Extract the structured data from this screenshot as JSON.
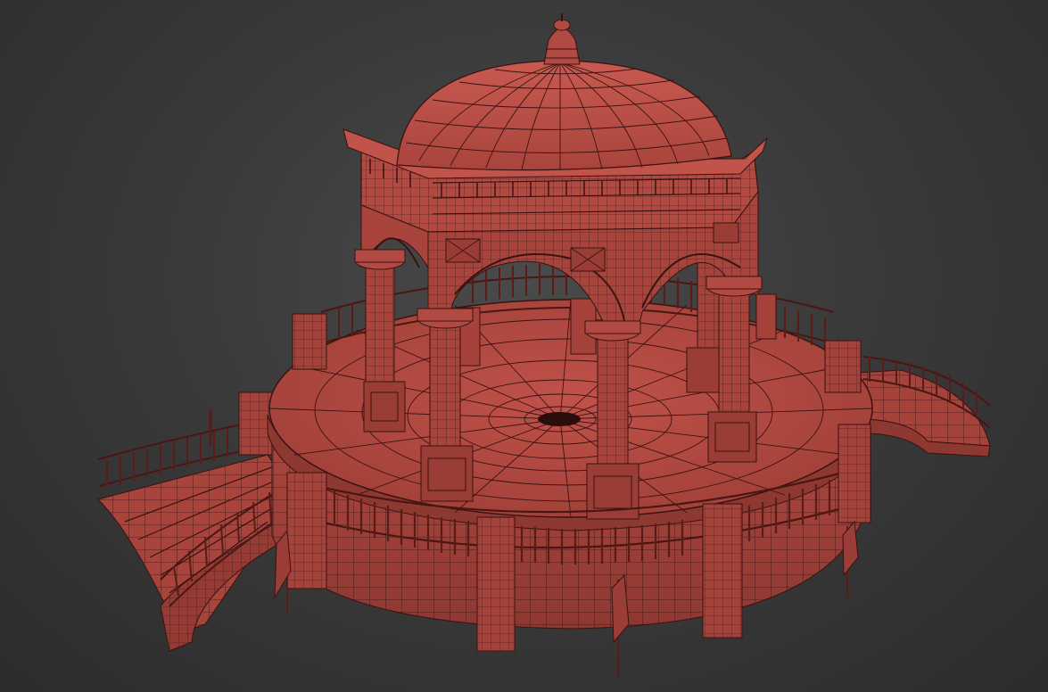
{
  "viewport": {
    "background_color": "#3c3c3c",
    "render_mode": "wireframe-shaded"
  },
  "model": {
    "subject": "gazebo",
    "fill_color": "#b0473f",
    "wire_color": "#3a1210",
    "shade_color": "#8a3630",
    "highlight_color": "#c8584e"
  }
}
